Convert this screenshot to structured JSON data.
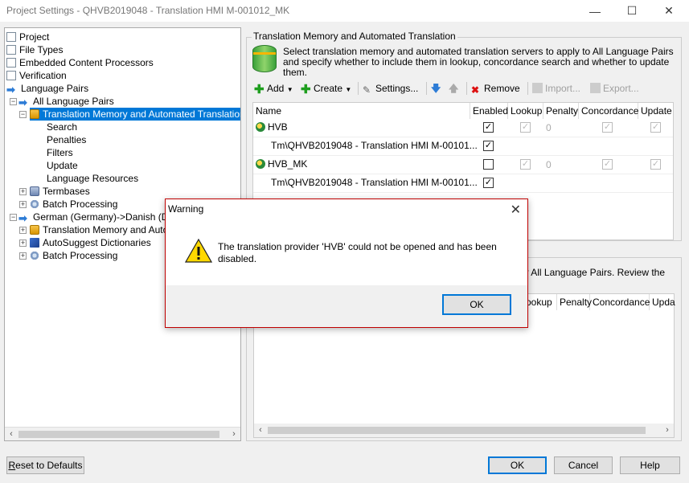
{
  "window": {
    "title": "Project Settings - QHVB2019048 - Translation HMI M-001012_MK",
    "minimize": "—",
    "maximize": "☐",
    "close": "✕"
  },
  "tree": {
    "items": [
      {
        "label": "Project",
        "icon": "document-icon"
      },
      {
        "label": "File Types",
        "icon": "document-icon"
      },
      {
        "label": "Embedded Content Processors",
        "icon": "document-icon"
      },
      {
        "label": "Verification",
        "icon": "document-icon"
      },
      {
        "label": "Language Pairs",
        "icon": "arrow-icon"
      },
      {
        "label": "All Language Pairs",
        "icon": "arrow-icon"
      },
      {
        "label": "Translation Memory and Automated Translation",
        "icon": "tm-icon"
      },
      {
        "label": "Search",
        "icon": ""
      },
      {
        "label": "Penalties",
        "icon": ""
      },
      {
        "label": "Filters",
        "icon": ""
      },
      {
        "label": "Update",
        "icon": ""
      },
      {
        "label": "Language Resources",
        "icon": ""
      },
      {
        "label": "Termbases",
        "icon": "termbase-icon"
      },
      {
        "label": "Batch Processing",
        "icon": "gear-icon"
      },
      {
        "label": "German (Germany)->Danish (Den",
        "icon": "arrow-icon"
      },
      {
        "label": "Translation Memory and Autom",
        "icon": "tm-icon"
      },
      {
        "label": "AutoSuggest Dictionaries",
        "icon": "book-icon"
      },
      {
        "label": "Batch Processing",
        "icon": "gear-icon"
      }
    ]
  },
  "tm_panel": {
    "title": "Translation Memory and Automated Translation",
    "description": "Select translation memory and automated translation servers to apply to All Language Pairs and specify whether to include them in lookup, concordance search and whether to update them.",
    "toolbar": {
      "add": "Add",
      "create": "Create",
      "settings": "Settings...",
      "remove": "Remove",
      "import": "Import...",
      "export": "Export..."
    },
    "columns": [
      "Name",
      "Enabled",
      "Lookup",
      "Penalty",
      "Concordance",
      "Update"
    ],
    "rows": [
      {
        "name": "HVB",
        "enabled": true,
        "penalty": "0"
      },
      {
        "name": "Tm\\QHVB2019048 - Translation HMI M-00101...",
        "enabled": true
      },
      {
        "name": "HVB_MK",
        "enabled": false,
        "penalty": "0"
      },
      {
        "name": "Tm\\QHVB2019048 - Translation HMI M-00101...",
        "enabled": true
      }
    ]
  },
  "lower_panel": {
    "text_fragment": "nder All Language Pairs. Review the",
    "columns": [
      "ookup",
      "Penalty",
      "Concordance",
      "Upda"
    ]
  },
  "buttons": {
    "reset": "eset to Defaults",
    "reset_key": "R",
    "ok": "OK",
    "cancel": "Cancel",
    "help": "Help"
  },
  "dialog": {
    "title": "Warning",
    "message": "The translation provider 'HVB' could not be opened and has been disabled.",
    "ok": "OK"
  },
  "colors": {
    "selection": "#0078d7",
    "dialog_border": "#c00000"
  }
}
